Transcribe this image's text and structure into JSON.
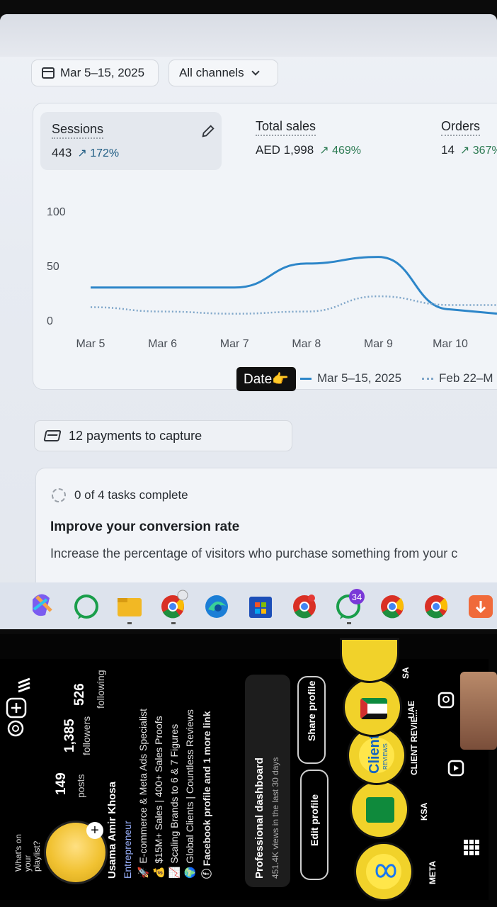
{
  "filters": {
    "date_range": "Mar 5–15, 2025",
    "channels": "All channels"
  },
  "metrics": [
    {
      "label": "Sessions",
      "value": "443",
      "delta": "172%"
    },
    {
      "label": "Total sales",
      "value": "AED 1,998",
      "delta": "469%"
    },
    {
      "label": "Orders",
      "value": "14",
      "delta": "367%"
    }
  ],
  "chart_data": {
    "type": "line",
    "x": [
      "Mar 5",
      "Mar 6",
      "Mar 7",
      "Mar 8",
      "Mar 9",
      "Mar 10"
    ],
    "yticks": [
      "100",
      "50",
      "0"
    ],
    "ylim": [
      0,
      100
    ],
    "series": [
      {
        "name": "Mar 5–15, 2025",
        "values": [
          30,
          30,
          30,
          52,
          58,
          10
        ],
        "style": "solid",
        "color": "#2d86c9"
      },
      {
        "name": "Feb 22–M",
        "values": [
          12,
          8,
          6,
          8,
          22,
          14
        ],
        "style": "dotted",
        "color": "#7fa6c9"
      }
    ]
  },
  "date_annotation": "Date👉",
  "payments": "12 payments to capture",
  "tasks": {
    "progress": "0 of 4 tasks complete",
    "title": "Improve your conversion rate",
    "description": "Increase the percentage of visitors who purchase something from your c"
  },
  "taskbar": {
    "badge_count": "34"
  },
  "instagram": {
    "story_prompt": "What's on your playlist?",
    "posts": "149",
    "posts_label": "posts",
    "followers": "1,385",
    "followers_label": "followers",
    "following": "526",
    "following_label": "following",
    "name": "Usama Amir Khosa",
    "category": "Entrepreneur",
    "bio": [
      "🚀 E-commerce & Meta Ads Specialist",
      "💰 $15M+ Sales | 400+ Sales Proofs",
      "📈 Scaling Brands to 6 & 7 Figures",
      "🌍 Global Clients | Countless Reviews",
      "ⓕ Facebook profile and 1 more link"
    ],
    "dashboard_title": "Professional dashboard",
    "dashboard_sub": "451.4K views in the last 30 days",
    "edit_button": "Edit profile",
    "share_button": "Share profile",
    "highlights": [
      "META",
      "KSA",
      "CLIENT REVIE...",
      "UAE",
      "SA"
    ],
    "highlight_client": "Client",
    "highlight_client_sub": "REVIEWS"
  }
}
